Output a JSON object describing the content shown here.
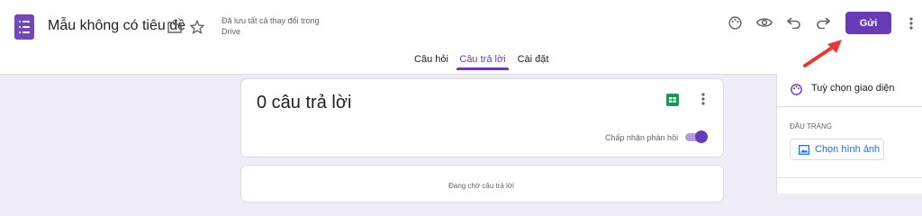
{
  "header": {
    "title": "Mẫu không có tiêu đề",
    "save_status": "Đã lưu tất cả thay đổi trong Drive",
    "send_label": "Gửi",
    "icons": [
      "folder-icon",
      "star-icon",
      "palette-icon",
      "eye-icon",
      "undo-icon",
      "redo-icon",
      "more-vert-icon"
    ]
  },
  "tabs": [
    {
      "label": "Câu hỏi"
    },
    {
      "label": "Câu trả lời"
    },
    {
      "label": "Cài đặt"
    }
  ],
  "responses_card": {
    "title": "0 câu trả lời",
    "accept_label": "Chấp nhận phản hồi",
    "accepting": true
  },
  "waiting_text": "Đang chờ câu trả lời",
  "theme_panel": {
    "title": "Tuỳ chọn giao diện",
    "section_label": "ĐẦU TRANG",
    "choose_image_label": "Chọn hình ảnh"
  },
  "colors": {
    "accent": "#673ab7",
    "background": "#efebf7",
    "sheets_green": "#0f9d58",
    "annotation_arrow": "#e53935"
  }
}
